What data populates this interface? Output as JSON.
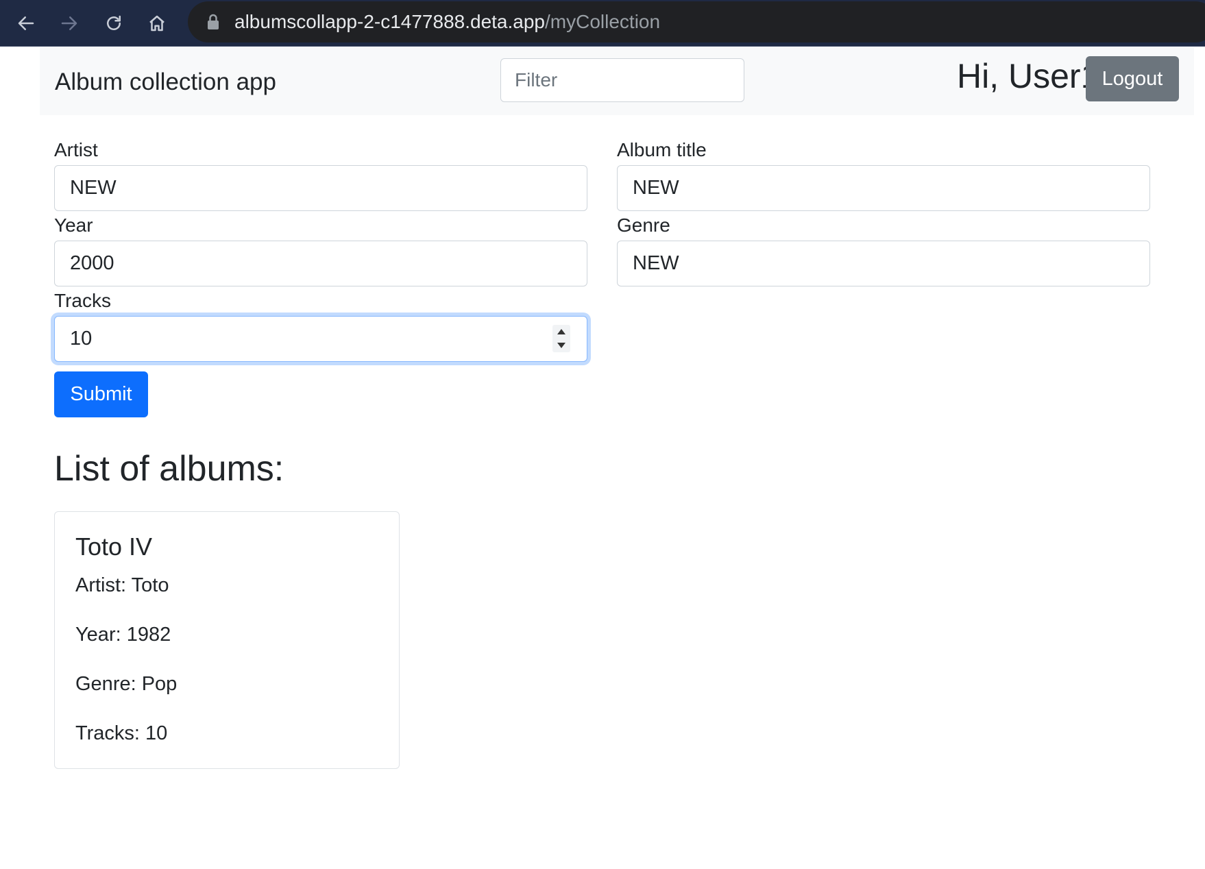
{
  "browser": {
    "url_host": "albumscollapp-2-c1477888.deta.app",
    "url_path": "/myCollection"
  },
  "navbar": {
    "brand": "Album collection app",
    "filter_placeholder": "Filter",
    "greeting": "Hi, User1",
    "logout_label": "Logout"
  },
  "form": {
    "artist": {
      "label": "Artist",
      "value": "NEW"
    },
    "album_title": {
      "label": "Album title",
      "value": "NEW"
    },
    "year": {
      "label": "Year",
      "value": "2000"
    },
    "genre": {
      "label": "Genre",
      "value": "NEW"
    },
    "tracks": {
      "label": "Tracks",
      "value": "10"
    },
    "submit_label": "Submit"
  },
  "albums": {
    "heading": "List of albums:",
    "items": [
      {
        "title": "Toto IV",
        "artist": "Artist: Toto",
        "year": "Year: 1982",
        "genre": "Genre: Pop",
        "tracks": "Tracks: 10"
      }
    ]
  },
  "colors": {
    "primary": "#0d6efd",
    "secondary": "#6c757d",
    "navbar_bg": "#f8f9fa",
    "chrome_bg": "#1f2a44"
  }
}
